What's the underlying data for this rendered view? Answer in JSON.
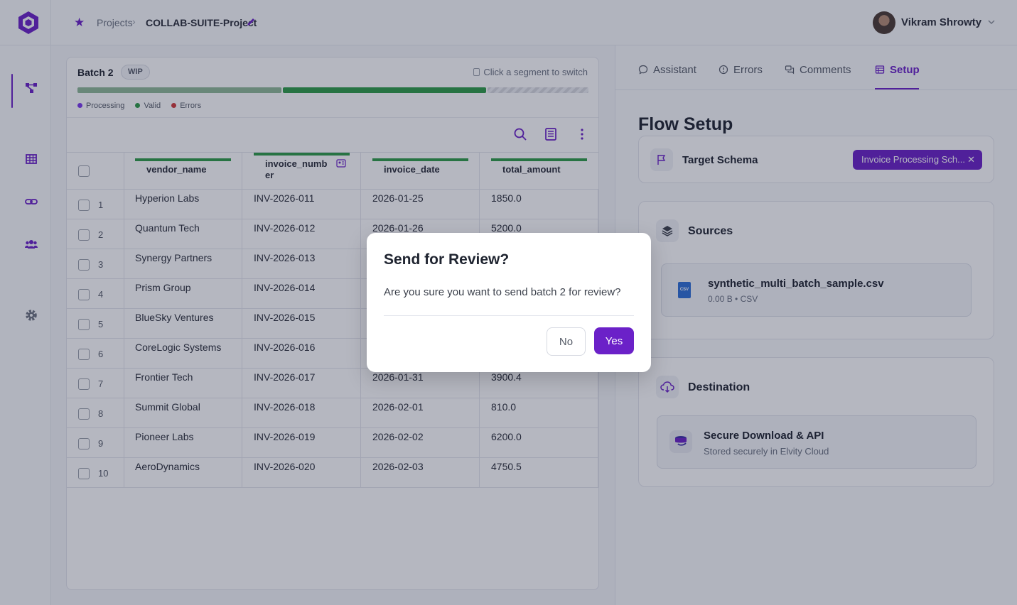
{
  "header": {
    "breadcrumb_root": "Projects",
    "project_name": "COLLAB-SUITE-Project",
    "user_name": "Vikram Shrowty"
  },
  "batch": {
    "title": "Batch 2",
    "status_badge": "WIP",
    "switch_hint": "Click a segment to switch",
    "legend": [
      "Processing",
      "Valid",
      "Errors"
    ]
  },
  "table": {
    "columns": [
      "vendor_name",
      "invoice_number",
      "invoice_date",
      "total_amount"
    ],
    "rows": [
      {
        "num": "1",
        "vendor_name": "Hyperion Labs",
        "invoice_number": "INV-2026-011",
        "invoice_date": "2026-01-25",
        "total_amount": "1850.0"
      },
      {
        "num": "2",
        "vendor_name": "Quantum Tech",
        "invoice_number": "INV-2026-012",
        "invoice_date": "2026-01-26",
        "total_amount": "5200.0"
      },
      {
        "num": "3",
        "vendor_name": "Synergy Partners",
        "invoice_number": "INV-2026-013",
        "invoice_date": "",
        "total_amount": ""
      },
      {
        "num": "4",
        "vendor_name": "Prism Group",
        "invoice_number": "INV-2026-014",
        "invoice_date": "",
        "total_amount": ""
      },
      {
        "num": "5",
        "vendor_name": "BlueSky Ventures",
        "invoice_number": "INV-2026-015",
        "invoice_date": "",
        "total_amount": ""
      },
      {
        "num": "6",
        "vendor_name": "CoreLogic Systems",
        "invoice_number": "INV-2026-016",
        "invoice_date": "",
        "total_amount": ""
      },
      {
        "num": "7",
        "vendor_name": "Frontier Tech",
        "invoice_number": "INV-2026-017",
        "invoice_date": "2026-01-31",
        "total_amount": "3900.4"
      },
      {
        "num": "8",
        "vendor_name": "Summit Global",
        "invoice_number": "INV-2026-018",
        "invoice_date": "2026-02-01",
        "total_amount": "810.0"
      },
      {
        "num": "9",
        "vendor_name": "Pioneer Labs",
        "invoice_number": "INV-2026-019",
        "invoice_date": "2026-02-02",
        "total_amount": "6200.0"
      },
      {
        "num": "10",
        "vendor_name": "AeroDynamics",
        "invoice_number": "INV-2026-020",
        "invoice_date": "2026-02-03",
        "total_amount": "4750.5"
      }
    ]
  },
  "right_panel": {
    "tabs": [
      {
        "label": "Assistant",
        "icon": "chat-icon"
      },
      {
        "label": "Errors",
        "icon": "alert-icon"
      },
      {
        "label": "Comments",
        "icon": "comments-icon"
      },
      {
        "label": "Setup",
        "icon": "setup-icon"
      }
    ],
    "active_tab": "Setup",
    "title": "Flow Setup",
    "target_schema": {
      "label": "Target Schema",
      "value": "Invoice Processing Sch..."
    },
    "sources": {
      "label": "Sources",
      "file_name": "synthetic_multi_batch_sample.csv",
      "file_meta": "0.00 B • CSV",
      "file_icon_text": "CSV"
    },
    "destination": {
      "label": "Destination",
      "name": "Secure Download & API",
      "meta": "Stored securely in Elvity Cloud"
    }
  },
  "modal": {
    "title": "Send for Review?",
    "body": "Are you sure you want to send batch 2 for review?",
    "no_label": "No",
    "yes_label": "Yes"
  },
  "colors": {
    "accent": "#6b21c8",
    "processing": "#7c3aed",
    "valid": "#2f9b47",
    "errors": "#d13a3a"
  }
}
